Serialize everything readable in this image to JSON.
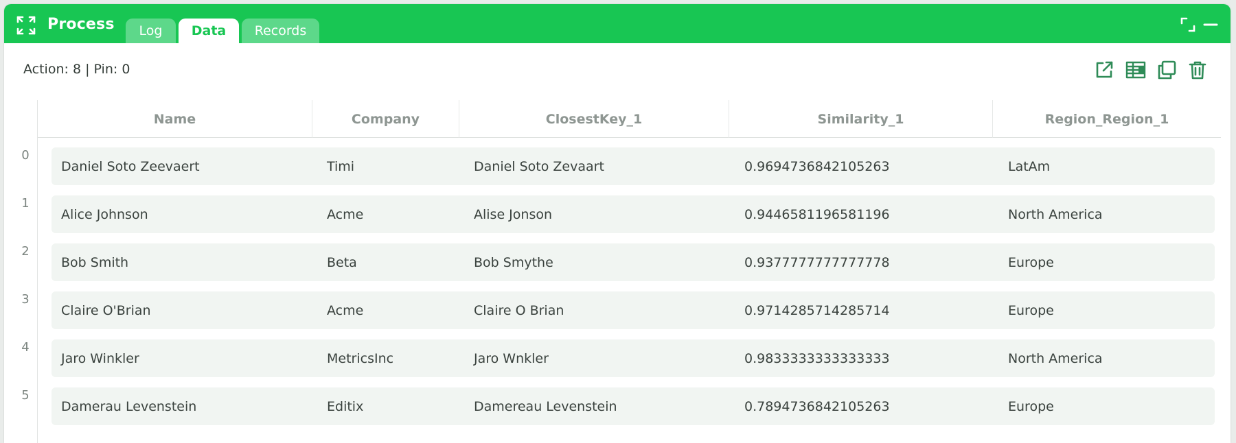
{
  "window": {
    "title": "Process",
    "icon": "expand-arrows-icon",
    "accent_color": "#18c653"
  },
  "tabs": [
    {
      "label": "Log",
      "active": false
    },
    {
      "label": "Data",
      "active": true
    },
    {
      "label": "Records",
      "active": false
    }
  ],
  "status": {
    "text": "Action: 8 | Pin: 0"
  },
  "toolbar": {
    "icons": [
      "open-external-icon",
      "table-view-icon",
      "copy-icon",
      "trash-icon"
    ]
  },
  "table": {
    "columns": [
      "Name",
      "Company",
      "ClosestKey_1",
      "Similarity_1",
      "Region_Region_1"
    ],
    "rows": [
      {
        "index": "0",
        "cells": [
          "Daniel Soto Zeevaert",
          "Timi",
          "Daniel Soto Zevaart",
          "0.9694736842105263",
          "LatAm"
        ]
      },
      {
        "index": "1",
        "cells": [
          "Alice Johnson",
          "Acme",
          "Alise Jonson",
          "0.9446581196581196",
          "North America"
        ]
      },
      {
        "index": "2",
        "cells": [
          "Bob Smith",
          "Beta",
          "Bob Smythe",
          "0.9377777777777778",
          "Europe"
        ]
      },
      {
        "index": "3",
        "cells": [
          "Claire O'Brian",
          "Acme",
          "Claire O Brian",
          "0.9714285714285714",
          "Europe"
        ]
      },
      {
        "index": "4",
        "cells": [
          "Jaro Winkler",
          "MetricsInc",
          "Jaro Wnkler",
          "0.9833333333333333",
          "North America"
        ]
      },
      {
        "index": "5",
        "cells": [
          "Damerau Levenstein",
          "Editix",
          "Damereau Levenstein",
          "0.7894736842105263",
          "Europe"
        ]
      }
    ]
  }
}
